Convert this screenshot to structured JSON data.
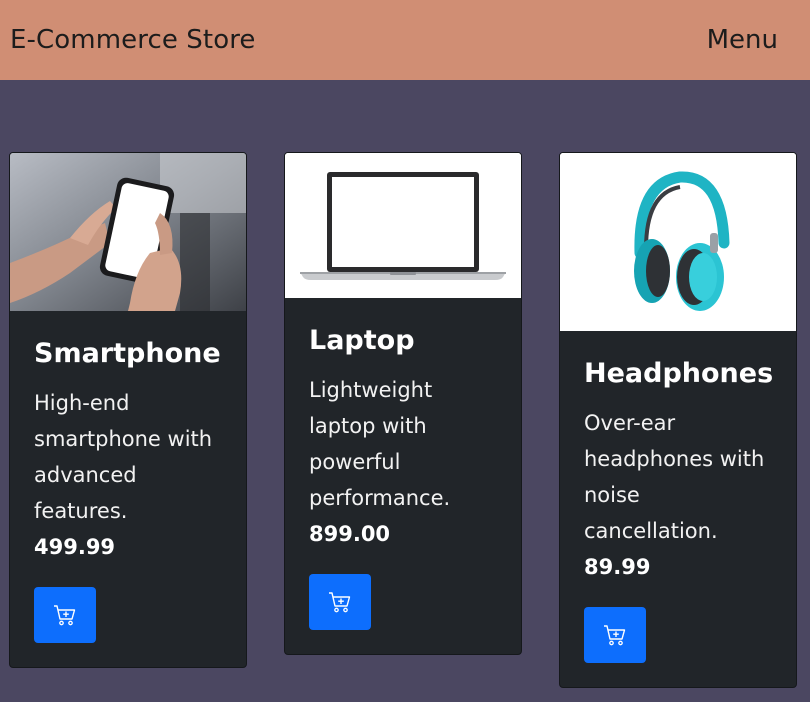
{
  "navbar": {
    "brand": "E-Commerce Store",
    "menu_label": "Menu"
  },
  "products": [
    {
      "name": "Smartphone",
      "description": "High-end smartphone with advanced features.",
      "price": "499.99",
      "image_icon": "smartphone-in-hand-photo",
      "button_icon": "cart-plus-icon"
    },
    {
      "name": "Laptop",
      "description": "Lightweight laptop with powerful performance.",
      "price": "899.00",
      "image_icon": "laptop-photo",
      "button_icon": "cart-plus-icon"
    },
    {
      "name": "Headphones",
      "description": "Over-ear headphones with noise cancellation.",
      "price": "89.99",
      "image_icon": "headphones-photo",
      "button_icon": "cart-plus-icon"
    }
  ],
  "colors": {
    "navbar": "#d08e74",
    "background": "#4b4761",
    "card": "#212529",
    "button": "#0d6efd"
  }
}
